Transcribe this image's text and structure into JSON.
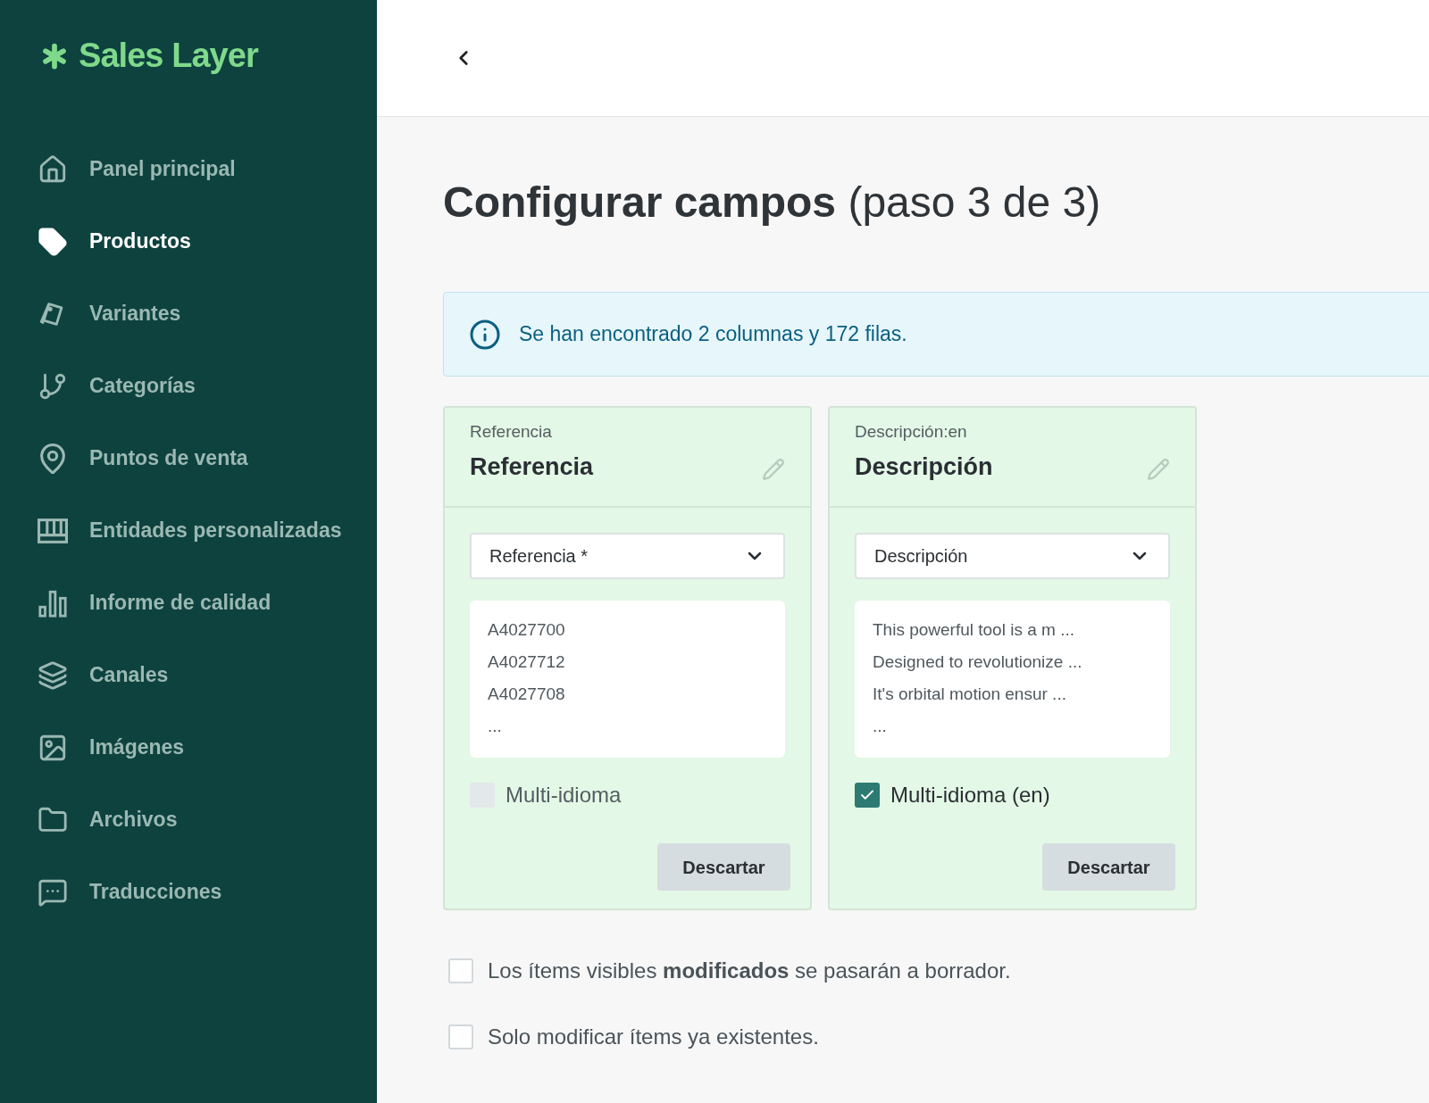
{
  "sidebar": {
    "logo": "Sales Layer",
    "items": [
      {
        "label": "Panel principal",
        "selected": false
      },
      {
        "label": "Productos",
        "selected": true
      },
      {
        "label": "Variantes",
        "selected": false
      },
      {
        "label": "Categorías",
        "selected": false
      },
      {
        "label": "Puntos de venta",
        "selected": false
      },
      {
        "label": "Entidades personalizadas",
        "selected": false
      },
      {
        "label": "Informe de calidad",
        "selected": false
      },
      {
        "label": "Canales",
        "selected": false
      },
      {
        "label": "Imágenes",
        "selected": false
      },
      {
        "label": "Archivos",
        "selected": false
      },
      {
        "label": "Traducciones",
        "selected": false
      }
    ]
  },
  "page": {
    "title": "**Configurar campos** (paso 3 de 3)",
    "info": "Se han encontrado 2 columnas y 172 filas.",
    "fields": [
      {
        "source": "Referencia",
        "name": "Referencia",
        "select": "Referencia *",
        "samples": [
          "A4027700",
          "A4027712",
          "A4027708",
          "..."
        ],
        "multilang": {
          "label": "Multi-idioma",
          "checked": false
        },
        "discard": "Descartar"
      },
      {
        "source": "Descripción:en",
        "name": "Descripción",
        "select": "Descripción",
        "samples": [
          "This powerful tool is a m ...",
          "Designed to revolutionize ...",
          "It's orbital motion ensur ...",
          "..."
        ],
        "multilang": {
          "label": "Multi-idioma (en)",
          "checked": true
        },
        "discard": "Descartar"
      }
    ],
    "options": [
      {
        "label": "Los ítems visibles **modificados** se pasarán a borrador.",
        "checked": false
      },
      {
        "label": "Solo modificar ítems ya existentes.",
        "checked": false
      }
    ]
  }
}
